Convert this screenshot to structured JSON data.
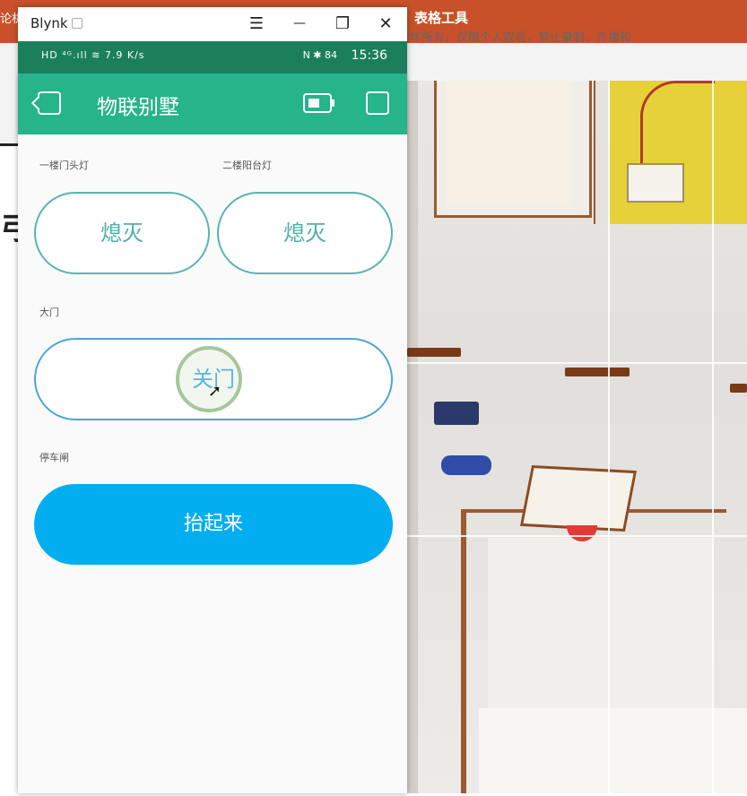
{
  "background": {
    "ribbon_left": "论机",
    "ribbon_tools": "表格工具",
    "copyright": "【版权声明】本课程版权归创客童年所有，仅限个人观看，禁止录制、传播和",
    "left_char": "弓"
  },
  "window": {
    "title": "Blynk",
    "controls": {
      "menu": "☰",
      "minimize": "—",
      "restore": "❐",
      "close": "✕"
    }
  },
  "statusbar": {
    "left": "HD ⁴ᴳ.ıll ≋ 7.9 K/s",
    "icons": "N ✱ 84",
    "time": "15:36"
  },
  "appbar": {
    "title": "物联别墅"
  },
  "widgets": {
    "light1": {
      "label": "一楼门头灯",
      "button": "熄灭"
    },
    "light2": {
      "label": "二楼阳台灯",
      "button": "熄灭"
    },
    "gate": {
      "label": "大门",
      "button": "关门"
    },
    "parking": {
      "label": "停车闸",
      "button": "抬起来"
    }
  },
  "colors": {
    "appbar": "#26b48a",
    "statusbar": "#1b7f5c",
    "outline_button": "#59b4ad",
    "gate_button": "#4ba7d4",
    "parking_button": "#02aef0",
    "ribbon": "#c8512a"
  }
}
